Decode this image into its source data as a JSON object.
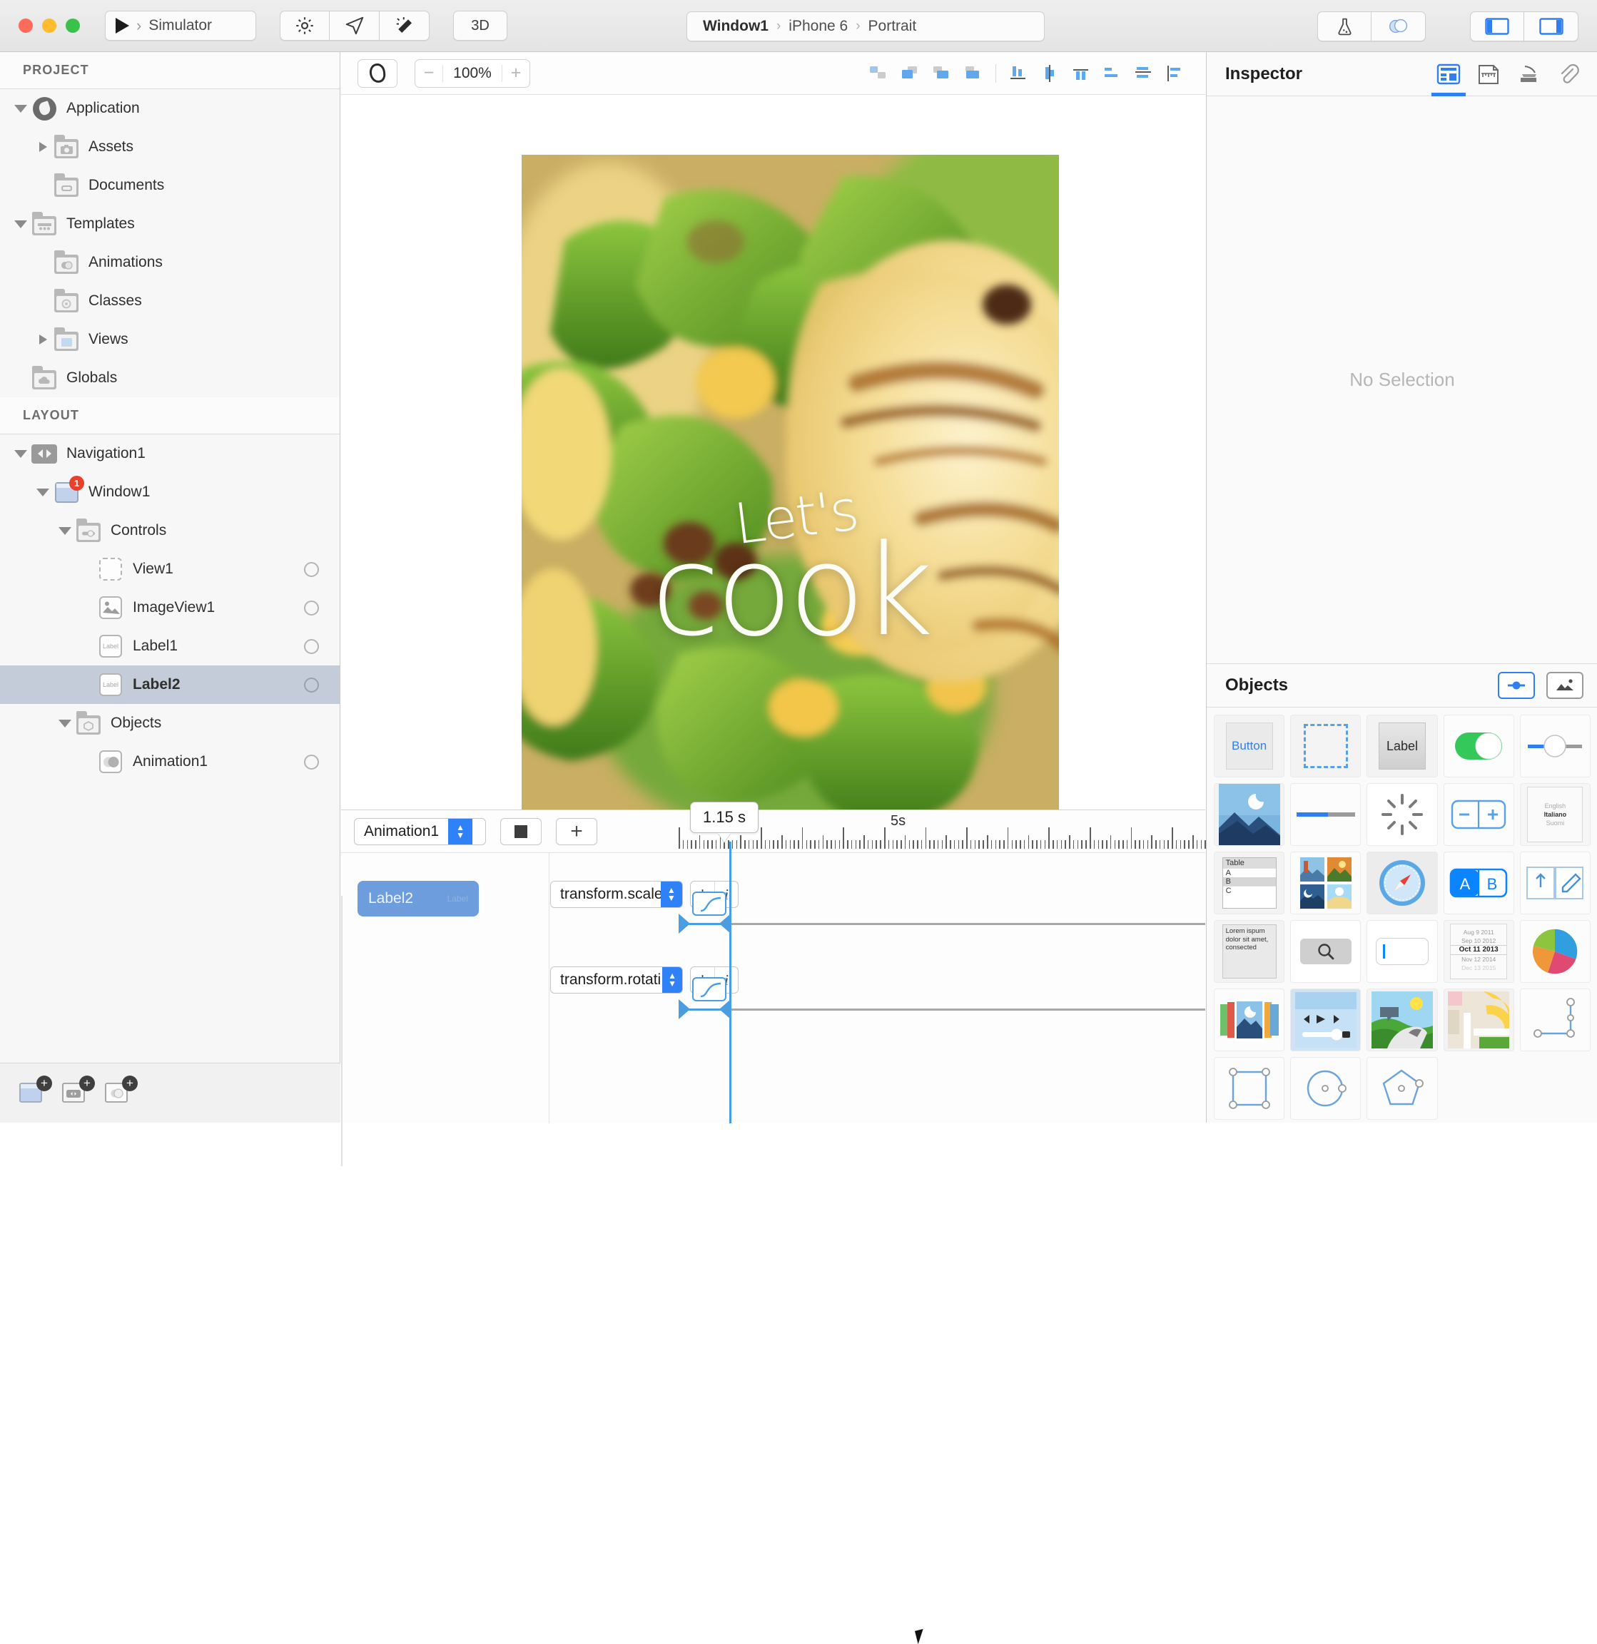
{
  "titlebar": {
    "run_label": "Simulator",
    "run_chevron": "›",
    "buttons": {
      "settings": "gear-icon",
      "send": "send-icon",
      "magic": "magic-wand-icon",
      "three_d": "3D"
    },
    "breadcrumb": {
      "window": "Window1",
      "device": "iPhone 6",
      "orientation": "Portrait",
      "separator": "›"
    },
    "right_buttons": [
      "flask-icon",
      "layers-icon",
      "left-panel-icon",
      "right-panel-icon"
    ]
  },
  "sidebar": {
    "project_header": "PROJECT",
    "layout_header": "LAYOUT",
    "project_items": [
      {
        "label": "Application",
        "icon": "app-icon",
        "indent": 0,
        "twisty": "open"
      },
      {
        "label": "Assets",
        "icon": "folder-camera-icon",
        "indent": 1,
        "twisty": "closed"
      },
      {
        "label": "Documents",
        "icon": "folder-doc-icon",
        "indent": 1,
        "twisty": "none"
      },
      {
        "label": "Templates",
        "icon": "folder-templates-icon",
        "indent": 0,
        "twisty": "open"
      },
      {
        "label": "Animations",
        "icon": "folder-anim-icon",
        "indent": 1,
        "twisty": "none"
      },
      {
        "label": "Classes",
        "icon": "folder-class-icon",
        "indent": 1,
        "twisty": "none"
      },
      {
        "label": "Views",
        "icon": "folder-views-icon",
        "indent": 1,
        "twisty": "closed"
      },
      {
        "label": "Globals",
        "icon": "folder-cloud-icon",
        "indent": 0,
        "twisty": "none"
      }
    ],
    "layout_items": [
      {
        "label": "Navigation1",
        "icon": "navigation-icon",
        "indent": 0,
        "twisty": "open",
        "dot": false,
        "selected": false,
        "badge": null
      },
      {
        "label": "Window1",
        "icon": "window-icon",
        "indent": 1,
        "twisty": "open",
        "dot": false,
        "selected": false,
        "badge": "1"
      },
      {
        "label": "Controls",
        "icon": "folder-controls-icon",
        "indent": 2,
        "twisty": "open",
        "dot": false,
        "selected": false,
        "badge": null
      },
      {
        "label": "View1",
        "icon": "view-icon",
        "indent": 3,
        "twisty": "none",
        "dot": true,
        "selected": false,
        "badge": null
      },
      {
        "label": "ImageView1",
        "icon": "imageview-icon",
        "indent": 3,
        "twisty": "none",
        "dot": true,
        "selected": false,
        "badge": null
      },
      {
        "label": "Label1",
        "icon": "label-icon",
        "indent": 3,
        "twisty": "none",
        "dot": true,
        "selected": false,
        "badge": null
      },
      {
        "label": "Label2",
        "icon": "label-icon",
        "indent": 3,
        "twisty": "none",
        "dot": true,
        "selected": true,
        "badge": null
      },
      {
        "label": "Objects",
        "icon": "folder-objects-icon",
        "indent": 2,
        "twisty": "open",
        "dot": false,
        "selected": false,
        "badge": null
      },
      {
        "label": "Animation1",
        "icon": "animation-icon",
        "indent": 3,
        "twisty": "none",
        "dot": true,
        "selected": false,
        "badge": null
      }
    ],
    "bottom_buttons": [
      "add-window-icon",
      "add-navigation-icon",
      "add-object-icon"
    ]
  },
  "canvas": {
    "select_tool": "lasso-select-icon",
    "zoom_minus": "−",
    "zoom_value": "100%",
    "zoom_plus": "+",
    "align_tools": [
      "distribute-icon",
      "bring-front-icon",
      "send-back-icon",
      "group-icon",
      "align-left-icon",
      "align-center-h-icon",
      "align-right-icon",
      "align-top-icon",
      "align-middle-v-icon",
      "align-bottom-icon"
    ],
    "preview": {
      "headline_small": "Let's",
      "headline_large": "cook"
    }
  },
  "timeline": {
    "animation_select": "Animation1",
    "stop_button": "stop-icon",
    "add_button": "+",
    "object_chip": {
      "name": "Label2",
      "kind": "Label"
    },
    "time_bubble": "1.15  s",
    "ruler_mark": "5s",
    "tracks": [
      {
        "property": "transform.scale",
        "add": "+",
        "info": "i",
        "ease": "ease-in-out-icon"
      },
      {
        "property": "transform.rotati...",
        "add": "+",
        "info": "i",
        "ease": "ease-in-out-icon"
      }
    ]
  },
  "inspector": {
    "title": "Inspector",
    "tabs": [
      "properties-icon",
      "layout-icon",
      "events-icon",
      "attachment-icon"
    ],
    "active_tab": 0,
    "empty_message": "No Selection"
  },
  "objects": {
    "title": "Objects",
    "view_toggles": [
      "controls-view-icon",
      "media-view-icon"
    ],
    "items": [
      {
        "name": "button-object",
        "label": "Button"
      },
      {
        "name": "view-object",
        "label": ""
      },
      {
        "name": "label-object",
        "label": "Label"
      },
      {
        "name": "switch-object",
        "label": ""
      },
      {
        "name": "slider-object",
        "label": ""
      },
      {
        "name": "imageview-object",
        "label": ""
      },
      {
        "name": "progressbar-object",
        "label": ""
      },
      {
        "name": "activity-indicator-object",
        "label": ""
      },
      {
        "name": "stepper-object",
        "label": ""
      },
      {
        "name": "picker-object",
        "label": "Italiano",
        "options": [
          "English",
          "Italiano",
          "Suomi"
        ]
      },
      {
        "name": "table-object",
        "label": "Table",
        "rows": [
          "A",
          "B",
          "C"
        ]
      },
      {
        "name": "collection-view-object",
        "label": ""
      },
      {
        "name": "webview-object",
        "label": ""
      },
      {
        "name": "segmented-control-object",
        "label": "A B"
      },
      {
        "name": "toolbar-object",
        "label": ""
      },
      {
        "name": "textview-object",
        "label": "Lorem ispum dolor sit amet, consected"
      },
      {
        "name": "searchbar-object",
        "label": ""
      },
      {
        "name": "textfield-object",
        "label": ""
      },
      {
        "name": "datepicker-object",
        "label": "Oct 11 2013",
        "rows": [
          "Aug  9 2011",
          "Sep 10 2012",
          "Oct 11 2013",
          "Nov 12 2014",
          "Dec 13 2015"
        ]
      },
      {
        "name": "chart-object",
        "label": ""
      },
      {
        "name": "carousel-object",
        "label": ""
      },
      {
        "name": "media-player-object",
        "label": ""
      },
      {
        "name": "scene-object",
        "label": ""
      },
      {
        "name": "map-object",
        "label": ""
      },
      {
        "name": "path-line-object",
        "label": ""
      },
      {
        "name": "path-rect-object",
        "label": ""
      },
      {
        "name": "path-circle-object",
        "label": ""
      },
      {
        "name": "path-polygon-object",
        "label": ""
      }
    ]
  },
  "colors": {
    "accent": "#2f7ff0",
    "timeline_blue": "#4a9de0",
    "chip_blue": "#6d9ddc",
    "badge_red": "#e8402a"
  }
}
